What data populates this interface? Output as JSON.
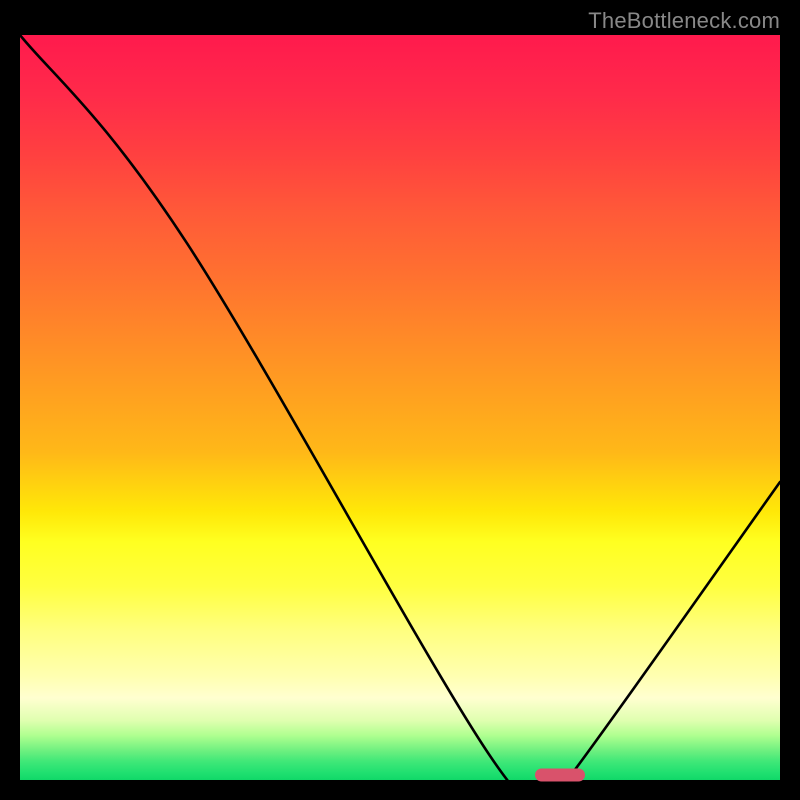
{
  "watermark": "TheBottleneck.com",
  "chart_data": {
    "type": "line",
    "title": "",
    "xlabel": "",
    "ylabel": "",
    "xlim": [
      0,
      100
    ],
    "ylim": [
      0,
      100
    ],
    "x": [
      0,
      22,
      62,
      70,
      72,
      100
    ],
    "values": [
      100,
      72,
      3,
      0,
      0,
      40
    ],
    "marker": {
      "x": 71,
      "y": 0.7
    },
    "background_gradient": {
      "top": "#ff1a4d",
      "mid": "#ffe808",
      "bottom": "#10d868"
    },
    "curve_stroke": "#000000",
    "curve_width": 2.6
  }
}
